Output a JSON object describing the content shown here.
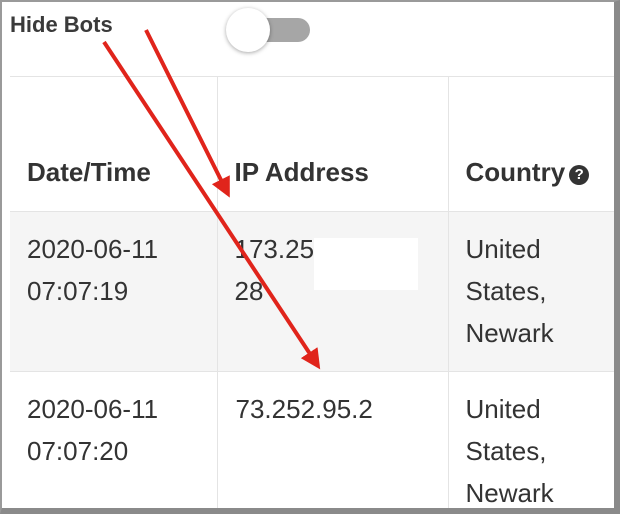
{
  "filter": {
    "hide_bots_label": "Hide Bots",
    "hide_bots_enabled": false
  },
  "table": {
    "columns": [
      "Date/Time",
      "IP Address",
      "Country"
    ],
    "rows": [
      {
        "date": "2020-06-11",
        "time": "07:07:19",
        "ip_start": "173.25",
        "ip_end": "28",
        "country_line1": "United",
        "country_line2": "States,",
        "country_line3": "Newark"
      },
      {
        "date": "2020-06-11",
        "time": "07:07:20",
        "ip": "73.252.95.2",
        "country_line1": "United",
        "country_line2": "States,",
        "country_line3": "Newark"
      }
    ]
  },
  "colors": {
    "arrow": "#e0241b",
    "toggle_track": "#a6a6a6",
    "row_alt": "#f5f5f5"
  }
}
